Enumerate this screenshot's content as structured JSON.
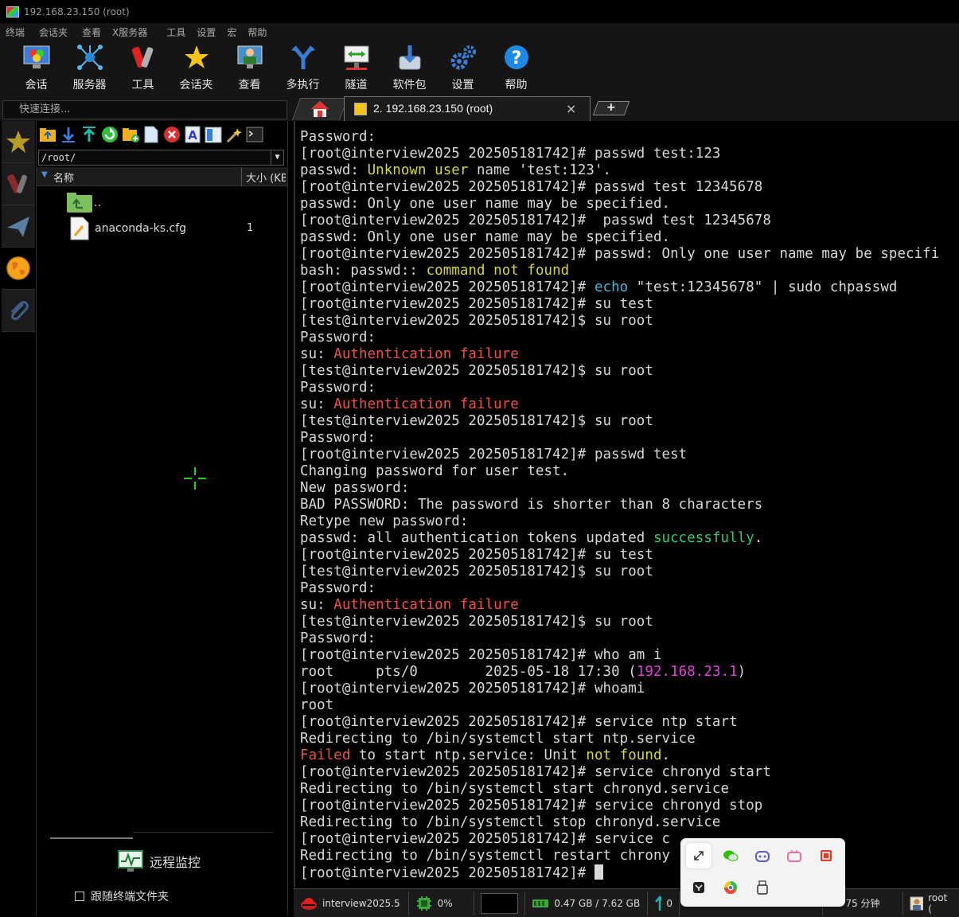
{
  "window": {
    "title": "192.168.23.150 (root)"
  },
  "menu": [
    "终端",
    "会话夹",
    "查看",
    "X服务器",
    "工具",
    "设置",
    "宏",
    "帮助"
  ],
  "toolbar": [
    {
      "label": "会话",
      "icon": "session-icon"
    },
    {
      "label": "服务器",
      "icon": "servers-icon"
    },
    {
      "label": "工具",
      "icon": "tools-icon"
    },
    {
      "label": "会话夹",
      "icon": "star-icon"
    },
    {
      "label": "查看",
      "icon": "view-icon"
    },
    {
      "label": "多执行",
      "icon": "multiexec-icon"
    },
    {
      "label": "隧道",
      "icon": "tunnel-icon"
    },
    {
      "label": "软件包",
      "icon": "packages-icon"
    },
    {
      "label": "设置",
      "icon": "gear-icon"
    },
    {
      "label": "帮助",
      "icon": "help-icon"
    }
  ],
  "quick_connect": {
    "placeholder": "快速连接..."
  },
  "tabs": {
    "active_label": "2. 192.168.23.150 (root)",
    "close": "×"
  },
  "sftp": {
    "path": "/root/",
    "columns": {
      "name": "名称",
      "size": "大小 (KB"
    },
    "files": [
      {
        "name": "..",
        "size": ""
      },
      {
        "name": "anaconda-ks.cfg",
        "size": "1"
      }
    ],
    "remote_monitor": "远程监控",
    "follow_folder": "跟随终端文件夹"
  },
  "terminal": {
    "lines": [
      [
        [
          "Password:",
          ""
        ]
      ],
      [
        [
          "[root@interview2025 202505181742]# passwd test:123",
          ""
        ]
      ],
      [
        [
          "passwd: ",
          ""
        ],
        [
          "Unknown user",
          "y"
        ],
        [
          " name 'test:123'.",
          ""
        ]
      ],
      [
        [
          "[root@interview2025 202505181742]# passwd test 12345678",
          ""
        ]
      ],
      [
        [
          "passwd: Only one user name may be specified.",
          ""
        ]
      ],
      [
        [
          "[root@interview2025 202505181742]#  passwd test 12345678",
          ""
        ]
      ],
      [
        [
          "passwd: Only one user name may be specified.",
          ""
        ]
      ],
      [
        [
          "[root@interview2025 202505181742]# passwd: Only one user name may be specifi",
          ""
        ]
      ],
      [
        [
          "bash: passwd:: ",
          ""
        ],
        [
          "command not found",
          "y"
        ]
      ],
      [
        [
          "[root@interview2025 202505181742]# ",
          ""
        ],
        [
          "echo",
          "c"
        ],
        [
          " \"test:12345678\" | sudo chpasswd",
          ""
        ]
      ],
      [
        [
          "[root@interview2025 202505181742]# su test",
          ""
        ]
      ],
      [
        [
          "[test@interview2025 202505181742]$ su root",
          ""
        ]
      ],
      [
        [
          "Password:",
          ""
        ]
      ],
      [
        [
          "su: ",
          ""
        ],
        [
          "Authentication failure",
          "r"
        ]
      ],
      [
        [
          "[test@interview2025 202505181742]$ su root",
          ""
        ]
      ],
      [
        [
          "Password:",
          ""
        ]
      ],
      [
        [
          "su: ",
          ""
        ],
        [
          "Authentication failure",
          "r"
        ]
      ],
      [
        [
          "[test@interview2025 202505181742]$ su root",
          ""
        ]
      ],
      [
        [
          "Password:",
          ""
        ]
      ],
      [
        [
          "[root@interview2025 202505181742]# passwd test",
          ""
        ]
      ],
      [
        [
          "Changing password for user test.",
          ""
        ]
      ],
      [
        [
          "New password:",
          ""
        ]
      ],
      [
        [
          "BAD PASSWORD: The password is shorter than 8 characters",
          ""
        ]
      ],
      [
        [
          "Retype new password:",
          ""
        ]
      ],
      [
        [
          "passwd: all authentication tokens updated ",
          ""
        ],
        [
          "successfully",
          "g"
        ],
        [
          ".",
          ""
        ]
      ],
      [
        [
          "[root@interview2025 202505181742]# su test",
          ""
        ]
      ],
      [
        [
          "[test@interview2025 202505181742]$ su root",
          ""
        ]
      ],
      [
        [
          "Password:",
          ""
        ]
      ],
      [
        [
          "su: ",
          ""
        ],
        [
          "Authentication failure",
          "r"
        ]
      ],
      [
        [
          "[test@interview2025 202505181742]$ su root",
          ""
        ]
      ],
      [
        [
          "Password:",
          ""
        ]
      ],
      [
        [
          "[root@interview2025 202505181742]# who am i",
          ""
        ]
      ],
      [
        [
          "root     pts/0        2025-05-18 17:30 (",
          ""
        ],
        [
          "192.168.23.1",
          "m"
        ],
        [
          ")",
          ""
        ]
      ],
      [
        [
          "[root@interview2025 202505181742]# whoami",
          ""
        ]
      ],
      [
        [
          "root",
          ""
        ]
      ],
      [
        [
          "[root@interview2025 202505181742]# service ntp start",
          ""
        ]
      ],
      [
        [
          "Redirecting to /bin/systemctl start ntp.service",
          ""
        ]
      ],
      [
        [
          "Failed",
          "r"
        ],
        [
          " to start ntp.service: Unit ",
          ""
        ],
        [
          "not found",
          "y"
        ],
        [
          ".",
          ""
        ]
      ],
      [
        [
          "[root@interview2025 202505181742]# service chronyd start",
          ""
        ]
      ],
      [
        [
          "Redirecting to /bin/systemctl start chronyd.service",
          ""
        ]
      ],
      [
        [
          "[root@interview2025 202505181742]# service chronyd stop",
          ""
        ]
      ],
      [
        [
          "Redirecting to /bin/systemctl stop chronyd.service",
          ""
        ]
      ],
      [
        [
          "[root@interview2025 202505181742]# service c",
          ""
        ]
      ],
      [
        [
          "Redirecting to /bin/systemctl restart chrony",
          ""
        ]
      ],
      [
        [
          "[root@interview2025 202505181742]# ",
          ""
        ]
      ]
    ]
  },
  "status": {
    "host": "interview2025.5",
    "cpu": "0%",
    "memory": "0.47 GB / 7.62 GB",
    "upload": "0",
    "uptime": "75 分钟",
    "user": "root ("
  }
}
